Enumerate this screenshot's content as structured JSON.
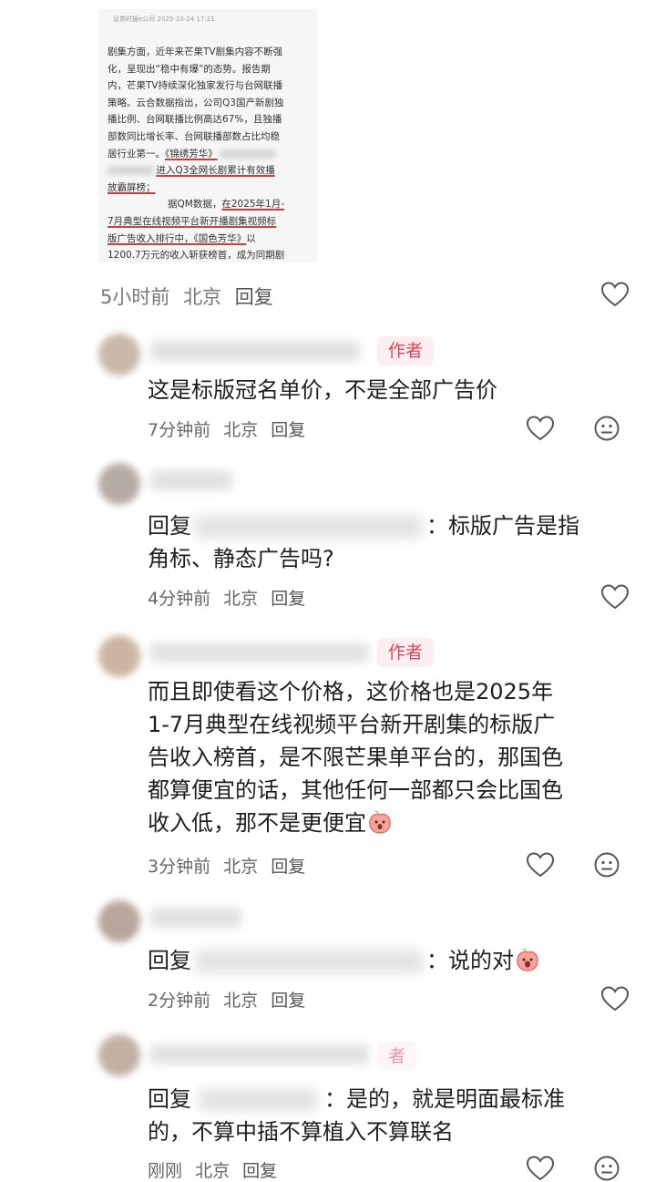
{
  "article": {
    "source": "证券时报e公司 2025-10-24 17:21",
    "line1": "剧集方面，近年来芒果TV剧集内容不断强",
    "line2": "化，呈现出“稳中有爆”的态势。报告期",
    "line3": "内，芒果TV持续深化独家发行与台网联播",
    "line4": "策略。云合数据指出，公司Q3国产新剧独",
    "line5": "播比例、台网联播比例高达67%，且独播",
    "line6": "部数同比增长率、台网联播部数占比均稳",
    "line7_a": "居行业第一。",
    "line7_b": "《锦绣芳华》",
    "line8": "进入Q3全网长剧累计有效播",
    "line9": "放霸屏榜；",
    "line10_a": "据QM数据，",
    "line10_b": "在2025年1月-",
    "line11": "7月典型在线视频平台新开播剧集视频标",
    "line12_a": "版广告收入排行中，",
    "line12_b": "《国色芳华》",
    "line12_c": "以",
    "line13": "1200.7万元的收入斩获榜首，成为同期剧"
  },
  "post_meta": {
    "time": "5小时前",
    "location": "北京",
    "reply": "回复"
  },
  "comments": [
    {
      "badge": "作者",
      "text": "这是标版冠名单价，不是全部广告价",
      "time": "7分钟前",
      "location": "北京",
      "reply": "回复"
    },
    {
      "prefix": "回复",
      "suffix": "：标版广告是指",
      "line2": "角标、静态广告吗?",
      "time": "4分钟前",
      "location": "北京",
      "reply": "回复"
    },
    {
      "badge": "作者",
      "line1": "而且即使看这个价格，这价格也是2025年",
      "line2": "1-7月典型在线视频平台新开剧集的标版广",
      "line3": "告收入榜首，是不限芒果单平台的，那国色",
      "line4": "都算便宜的话，其他任何一部都只会比国色",
      "line5": "收入低，那不是更便宜",
      "time": "3分钟前",
      "location": "北京",
      "reply": "回复"
    },
    {
      "prefix": "回复",
      "suffix": "：说的对",
      "time": "2分钟前",
      "location": "北京",
      "reply": "回复"
    },
    {
      "badge": "者",
      "prefix": "回复",
      "suffix": "：是的，就是明面最标准",
      "line2": "的，不算中插不算植入不算联名",
      "time": "刚刚",
      "location": "北京",
      "reply": "回复"
    }
  ],
  "colors": {
    "badge_bg": "#fdeef0",
    "badge_text": "#e04458",
    "underline": "#d23c3c"
  },
  "icons": [
    "heart-icon",
    "neutral-face-icon",
    "peach-emoji-icon"
  ]
}
